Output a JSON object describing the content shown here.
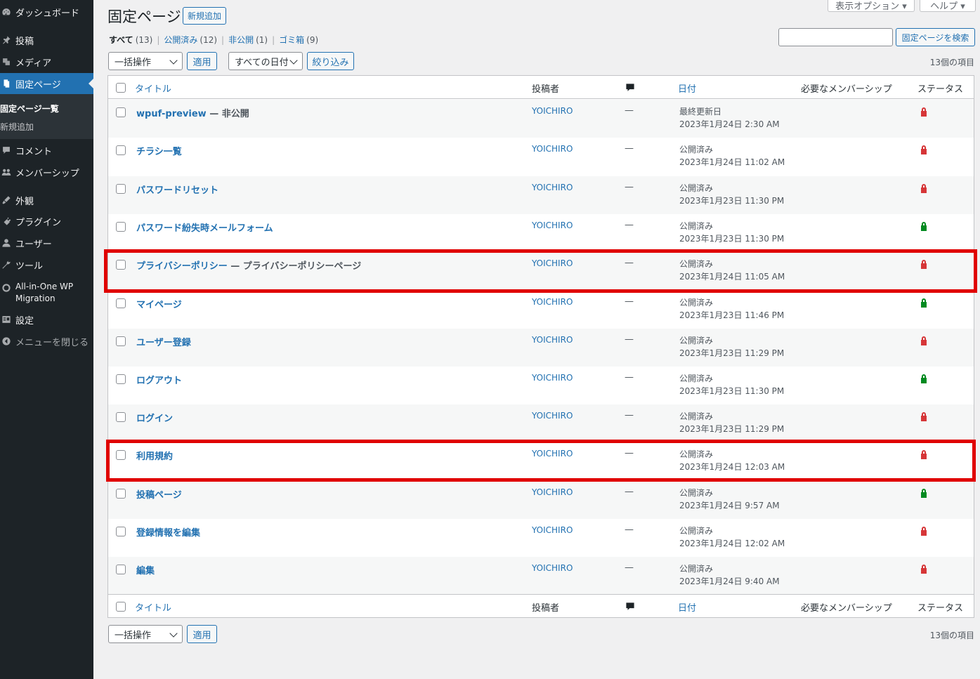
{
  "sidebar": {
    "items": [
      {
        "label": "ダッシュボード",
        "icon": "dashboard-icon"
      },
      {
        "label": "投稿",
        "icon": "pin-icon"
      },
      {
        "label": "メディア",
        "icon": "media-icon"
      },
      {
        "label": "固定ページ",
        "icon": "pages-icon"
      },
      {
        "label": "コメント",
        "icon": "comment-icon"
      },
      {
        "label": "メンバーシップ",
        "icon": "membership-icon"
      },
      {
        "label": "外観",
        "icon": "appearance-icon"
      },
      {
        "label": "プラグイン",
        "icon": "plugin-icon"
      },
      {
        "label": "ユーザー",
        "icon": "user-icon"
      },
      {
        "label": "ツール",
        "icon": "wrench-icon"
      },
      {
        "label": "All-in-One WP Migration",
        "icon": "migration-icon"
      },
      {
        "label": "設定",
        "icon": "settings-icon"
      },
      {
        "label": "メニューを閉じる",
        "icon": "collapse-icon"
      }
    ],
    "submenu": [
      "固定ページ一覧",
      "新規追加"
    ]
  },
  "screen_options": {
    "display": "表示オプション ▾",
    "help": "ヘルプ ▾"
  },
  "page": {
    "title": "固定ページ",
    "add_new": "新規追加"
  },
  "filters": {
    "all": "すべて",
    "all_count": "(13)",
    "published": "公開済み",
    "published_count": "(12)",
    "private": "非公開",
    "private_count": "(1)",
    "trash": "ゴミ箱",
    "trash_count": "(9)",
    "sep": "|"
  },
  "search": {
    "button": "固定ページを検索",
    "value": ""
  },
  "toolbar": {
    "bulk": "一括操作",
    "apply": "適用",
    "dates": "すべての日付",
    "filter": "絞り込み",
    "count": "13個の項目"
  },
  "table": {
    "headers": {
      "title": "タイトル",
      "author": "投稿者",
      "date": "日付",
      "membership": "必要なメンバーシップ",
      "status": "ステータス"
    },
    "rows": [
      {
        "title": "wpuf-preview",
        "state": "— 非公開",
        "author": "YOICHIRO",
        "comments": "—",
        "date_status": "最終更新日",
        "date": "2023年1月24日 2:30 AM",
        "lock": "locked"
      },
      {
        "title": "チラシ一覧",
        "state": "",
        "author": "YOICHIRO",
        "comments": "—",
        "date_status": "公開済み",
        "date": "2023年1月24日 11:02 AM",
        "lock": "locked"
      },
      {
        "title": "パスワードリセット",
        "state": "",
        "author": "YOICHIRO",
        "comments": "—",
        "date_status": "公開済み",
        "date": "2023年1月23日 11:30 PM",
        "lock": "locked"
      },
      {
        "title": "パスワード紛失時メールフォーム",
        "state": "",
        "author": "YOICHIRO",
        "comments": "—",
        "date_status": "公開済み",
        "date": "2023年1月23日 11:30 PM",
        "lock": "unlocked"
      },
      {
        "title": "プライバシーポリシー",
        "state": "— プライバシーポリシーページ",
        "author": "YOICHIRO",
        "comments": "—",
        "date_status": "公開済み",
        "date": "2023年1月24日 11:05 AM",
        "lock": "locked"
      },
      {
        "title": "マイページ",
        "state": "",
        "author": "YOICHIRO",
        "comments": "—",
        "date_status": "公開済み",
        "date": "2023年1月23日 11:46 PM",
        "lock": "unlocked"
      },
      {
        "title": "ユーザー登録",
        "state": "",
        "author": "YOICHIRO",
        "comments": "—",
        "date_status": "公開済み",
        "date": "2023年1月23日 11:29 PM",
        "lock": "locked"
      },
      {
        "title": "ログアウト",
        "state": "",
        "author": "YOICHIRO",
        "comments": "—",
        "date_status": "公開済み",
        "date": "2023年1月23日 11:30 PM",
        "lock": "unlocked"
      },
      {
        "title": "ログイン",
        "state": "",
        "author": "YOICHIRO",
        "comments": "—",
        "date_status": "公開済み",
        "date": "2023年1月23日 11:29 PM",
        "lock": "locked"
      },
      {
        "title": "利用規約",
        "state": "",
        "author": "YOICHIRO",
        "comments": "—",
        "date_status": "公開済み",
        "date": "2023年1月24日 12:03 AM",
        "lock": "locked"
      },
      {
        "title": "投稿ページ",
        "state": "",
        "author": "YOICHIRO",
        "comments": "—",
        "date_status": "公開済み",
        "date": "2023年1月24日 9:57 AM",
        "lock": "unlocked"
      },
      {
        "title": "登録情報を編集",
        "state": "",
        "author": "YOICHIRO",
        "comments": "—",
        "date_status": "公開済み",
        "date": "2023年1月24日 12:02 AM",
        "lock": "locked"
      },
      {
        "title": "編集",
        "state": "",
        "author": "YOICHIRO",
        "comments": "—",
        "date_status": "公開済み",
        "date": "2023年1月24日 9:40 AM",
        "lock": "locked"
      }
    ]
  },
  "colors": {
    "locked": "#d63638",
    "unlocked": "#008a20",
    "highlight": "#e00000",
    "accent": "#2271b1"
  }
}
